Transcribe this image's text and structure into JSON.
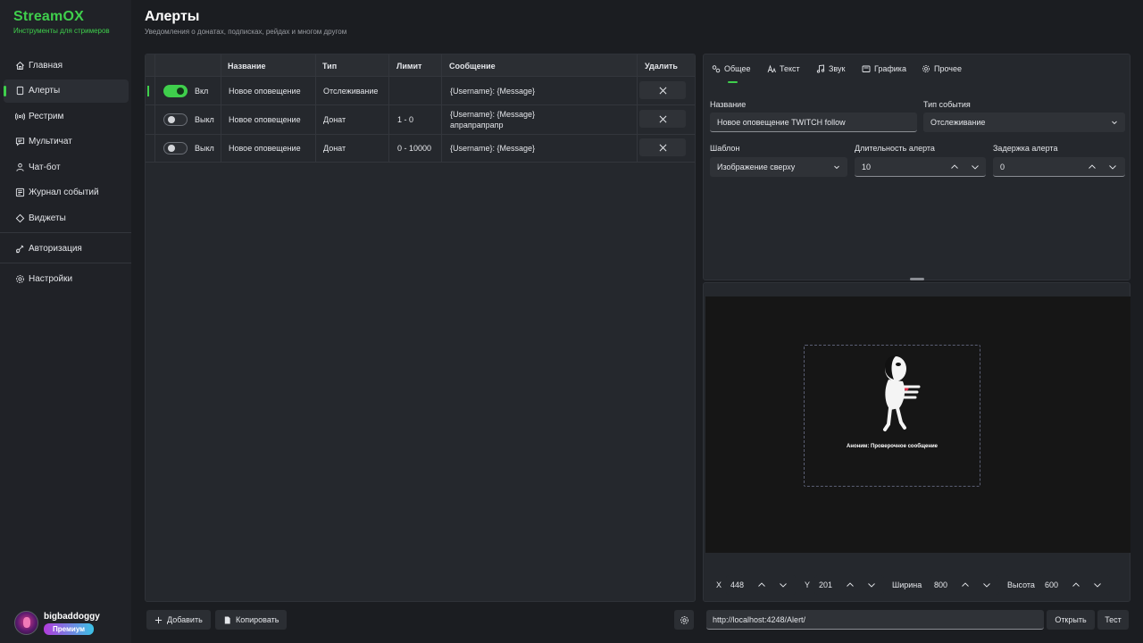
{
  "app": {
    "title": "StreamOX",
    "subtitle": "Инструменты для стримеров"
  },
  "sidebar": {
    "items": [
      {
        "label": "Главная",
        "icon": "home-icon"
      },
      {
        "label": "Алерты",
        "icon": "alerts-icon",
        "active": true
      },
      {
        "label": "Рестрим",
        "icon": "broadcast-icon"
      },
      {
        "label": "Мультичат",
        "icon": "chat-icon"
      },
      {
        "label": "Чат-бот",
        "icon": "bot-icon"
      },
      {
        "label": "Журнал событий",
        "icon": "log-icon"
      },
      {
        "label": "Виджеты",
        "icon": "widgets-icon"
      }
    ],
    "auth_label": "Авторизация",
    "settings_label": "Настройки"
  },
  "profile": {
    "username": "bigbaddoggy",
    "badge": "Премиум"
  },
  "page": {
    "title": "Алерты",
    "subtitle": "Уведомления о донатах, подписках, рейдах и многом другом"
  },
  "table": {
    "columns": {
      "name": "Название",
      "type": "Тип",
      "limit": "Лимит",
      "message": "Сообщение",
      "delete": "Удалить"
    },
    "rows": [
      {
        "state": "Вкл",
        "enabled": true,
        "name": "Новое оповещение",
        "type": "Отслеживание",
        "limit": "",
        "message": "{Username}: {Message}"
      },
      {
        "state": "Выкл",
        "enabled": false,
        "name": "Новое оповещение",
        "type": "Донат",
        "limit": "1 - 0",
        "message": "{Username}: {Message}\nапрапрапрапр"
      },
      {
        "state": "Выкл",
        "enabled": false,
        "name": "Новое оповещение",
        "type": "Донат",
        "limit": "0 - 10000",
        "message": "{Username}: {Message}"
      }
    ]
  },
  "toolbar": {
    "add_label": "Добавить",
    "copy_label": "Копировать"
  },
  "settings": {
    "tabs": [
      "Общее",
      "Текст",
      "Звук",
      "Графика",
      "Прочее"
    ],
    "active_tab": "Общее",
    "name_label": "Название",
    "name_value": "Новое оповещение TWITCH follow",
    "event_type_label": "Тип события",
    "event_type_value": "Отслеживание",
    "template_label": "Шаблон",
    "template_value": "Изображение сверху",
    "duration_label": "Длительность алерта",
    "duration_value": "10",
    "delay_label": "Задержка алерта",
    "delay_value": "0"
  },
  "preview": {
    "message": "Аноним: Проверочное сообщение",
    "x_label": "X",
    "x_value": "448",
    "y_label": "Y",
    "y_value": "201",
    "width_label": "Ширина",
    "width_value": "800",
    "height_label": "Высота",
    "height_value": "600"
  },
  "url_bar": {
    "url": "http://localhost:4248/Alert/",
    "open_label": "Открыть",
    "test_label": "Тест"
  },
  "colors": {
    "accent": "#3fcf4c",
    "background": "#1b1d21",
    "panel": "#25282d"
  }
}
